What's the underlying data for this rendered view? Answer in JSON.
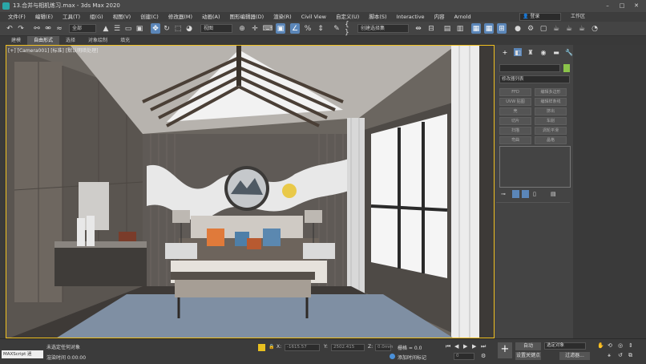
{
  "window": {
    "title": "13.合并与相机练习.max - 3ds Max 2020"
  },
  "menus": [
    "文件(F)",
    "编辑(E)",
    "工具(T)",
    "组(G)",
    "视图(V)",
    "创建(C)",
    "修改器(M)",
    "动画(A)",
    "图形编辑器(D)",
    "渲染(R)",
    "Civil View",
    "自定义(U)",
    "脚本(S)",
    "Interactive",
    "内容",
    "Arnold"
  ],
  "login": {
    "label": "登录",
    "workspace_label": "工作区"
  },
  "toolbar": {
    "filter_value": "全部",
    "view_value": "视图",
    "selection_set_placeholder": "创建选择集"
  },
  "ribbon_tabs": [
    {
      "label": "建模",
      "active": false
    },
    {
      "label": "自由形式",
      "active": true
    },
    {
      "label": "选择",
      "active": false
    },
    {
      "label": "对象绘制",
      "active": false
    },
    {
      "label": "填充",
      "active": false
    }
  ],
  "viewport": {
    "label": "[+] [Camera001] [标准] [默认明暗处理]"
  },
  "command_panel": {
    "modifier_list": "修改器列表",
    "buttons": [
      "FFD",
      "编辑多边形",
      "UVW 贴图",
      "编辑样条线",
      "壳",
      "挤出",
      "切片",
      "车削",
      "扫描",
      "涡轮平滑",
      "弯曲",
      "晶格"
    ]
  },
  "status": {
    "script_label": "MAXScript 迷",
    "line1": "未选定任何对象",
    "line2": "渲染时间 0:00:00",
    "x_label": "X:",
    "x_placeholder": "-1615.57",
    "y_label": "Y:",
    "y_placeholder": "2502.415",
    "z_label": "Z:",
    "z_placeholder": "0.0mm",
    "grid": "栅格 = 0.0",
    "add_time_tag": "添加时间标记",
    "frame": "0",
    "auto_key": "自动",
    "set_key": "设置关键点",
    "selected_object": "选定对象",
    "key_filters": "过滤器..."
  },
  "colors": {
    "accent": "#5b86b8",
    "cursor_highlight": "#e8c020",
    "swatch": "#8bc34a"
  }
}
